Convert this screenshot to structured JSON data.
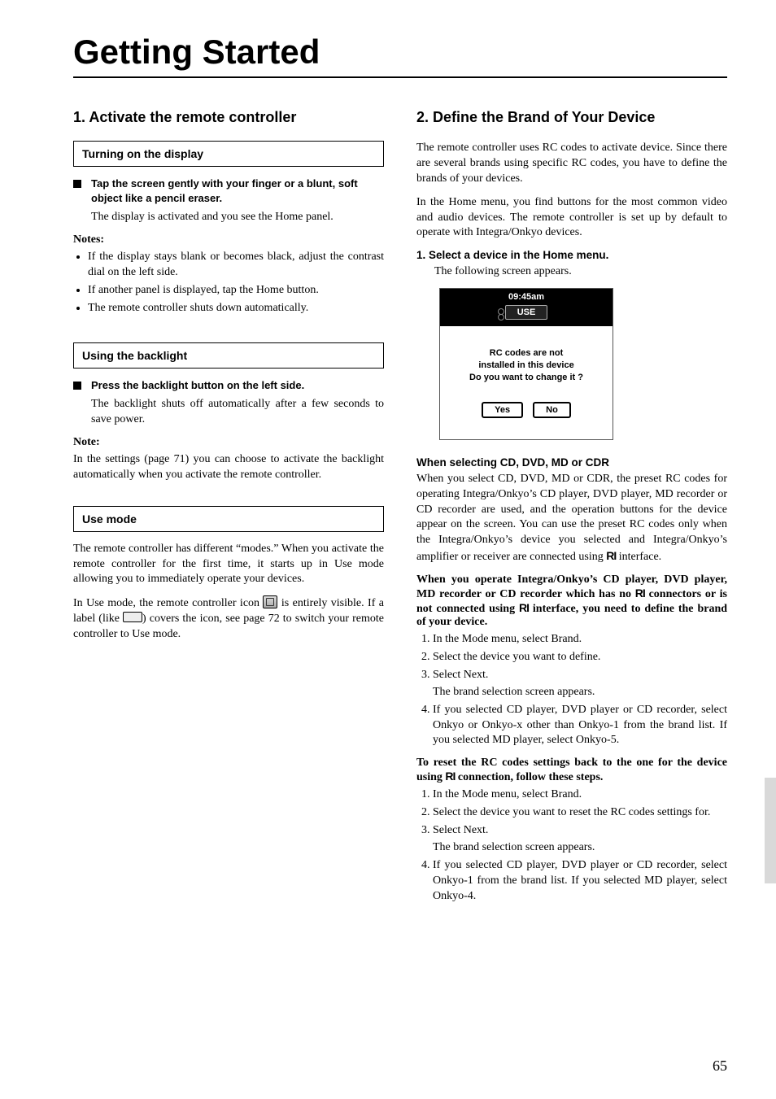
{
  "title": "Getting Started",
  "page_number": "65",
  "left": {
    "sec1_heading": "1. Activate the remote controller",
    "box1": "Turning on the display",
    "tap_instruction": "Tap the screen gently with your finger or a blunt, soft object like a pencil eraser.",
    "tap_result": "The display is activated and you see the Home panel.",
    "notes_label": "Notes:",
    "notes": [
      "If the display stays blank or becomes black, adjust the contrast dial on the left side.",
      "If another panel is displayed, tap the Home button.",
      "The remote controller shuts down automatically."
    ],
    "box2": "Using the backlight",
    "backlight_instruction": "Press the backlight button on the left side.",
    "backlight_result": "The backlight shuts off automatically after a few seconds to save power.",
    "note_label_single": "Note:",
    "backlight_note": "In the settings (page 71) you can choose to activate the backlight automatically when you activate the remote controller.",
    "box3": "Use mode",
    "usemode_p1": "The remote controller has different “modes.” When you activate the remote controller for the first time, it starts up in Use mode allowing you to immediately operate your devices.",
    "usemode_p2a": "In Use mode, the remote controller icon ",
    "usemode_p2b": " is entirely visible. If a label (like ",
    "usemode_p2c": ") covers the icon, see page 72 to switch your remote controller to Use mode."
  },
  "right": {
    "sec2_heading": "2. Define the Brand of Your Device",
    "intro_p1": "The remote controller uses RC codes to activate device. Since there are several brands using specific RC codes, you have to define the brands of your devices.",
    "intro_p2": "In the Home menu, you find buttons for the most common video and audio devices. The remote controller is set up by default to operate with Integra/Onkyo devices.",
    "step1_label": "1.  Select a device in the Home menu.",
    "step1_result": "The following screen appears.",
    "screenshot": {
      "time": "09:45am",
      "chip": "USE",
      "line1": "RC codes are not",
      "line2": "installed in this device",
      "line3": "Do you want to change it ?",
      "btn_yes": "Yes",
      "btn_no": "No"
    },
    "sel_heading": "When selecting CD, DVD, MD or CDR",
    "sel_p1a": "When you select CD, DVD, MD or CDR, the preset RC codes for operating Integra/Onkyo’s CD player, DVD player, MD recorder or CD recorder are used, and the operation buttons for the device appear on the screen. You can use the preset RC codes only when the Integra/Onkyo’s device you selected and Integra/Onkyo’s amplifier or receiver are connected using ",
    "sel_p1b": " interface.",
    "sel_bold_a": "When you operate Integra/Onkyo’s CD player, DVD player, MD recorder or CD recorder which has no ",
    "sel_bold_b": " connectors or is not connected using ",
    "sel_bold_c": " interface, you need to define the brand of your device.",
    "steps_a": [
      "In the Mode menu, select Brand.",
      "Select the device you want to define.",
      "Select Next."
    ],
    "steps_a_sub": "The brand selection screen appears.",
    "steps_a_4": "If you selected CD player, DVD player or CD recorder, select Onkyo or Onkyo-x other than Onkyo-1 from the brand list. If you selected MD player, select Onkyo-5.",
    "reset_heading_a": "To reset the RC codes settings back to the one for the device using ",
    "reset_heading_b": " connection, follow these steps.",
    "steps_b": [
      "In the Mode menu, select Brand.",
      "Select the device you want to reset the RC codes settings for.",
      "Select Next."
    ],
    "steps_b_sub": "The brand selection screen appears.",
    "steps_b_4": "If you selected CD player, DVD player or CD recorder, select Onkyo-1 from the brand list. If you selected MD player, select Onkyo-4.",
    "ri_label": "RI"
  }
}
